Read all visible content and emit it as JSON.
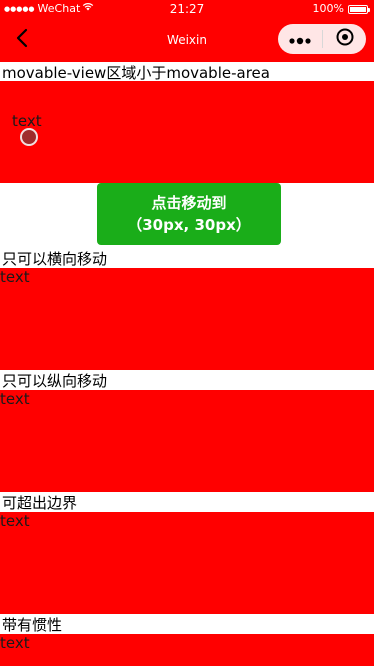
{
  "status_bar": {
    "signal": "●●●●●",
    "carrier": "WeChat",
    "wifi_icon": "wifi-icon",
    "time": "21:27",
    "battery_percent": "100%",
    "battery_icon": "battery-icon"
  },
  "nav": {
    "title": "Weixin",
    "back_icon": "chevron-left-icon",
    "more_icon": "more-dots-icon",
    "close_icon": "circle-dot-icon"
  },
  "colors": {
    "area_bg": "#ff0000",
    "button_bg": "#1aad19",
    "page_bg": "#ffffff"
  },
  "sections": [
    {
      "title": "movable-view区域小于movable-area",
      "view_text": "text"
    },
    {
      "title": "只可以横向移动",
      "view_text": "text"
    },
    {
      "title": "只可以纵向移动",
      "view_text": "text"
    },
    {
      "title": "可超出边界",
      "view_text": "text"
    },
    {
      "title": "带有惯性",
      "view_text": "text"
    }
  ],
  "move_button": {
    "line1": "点击移动到",
    "line2": "（30px, 30px）"
  }
}
